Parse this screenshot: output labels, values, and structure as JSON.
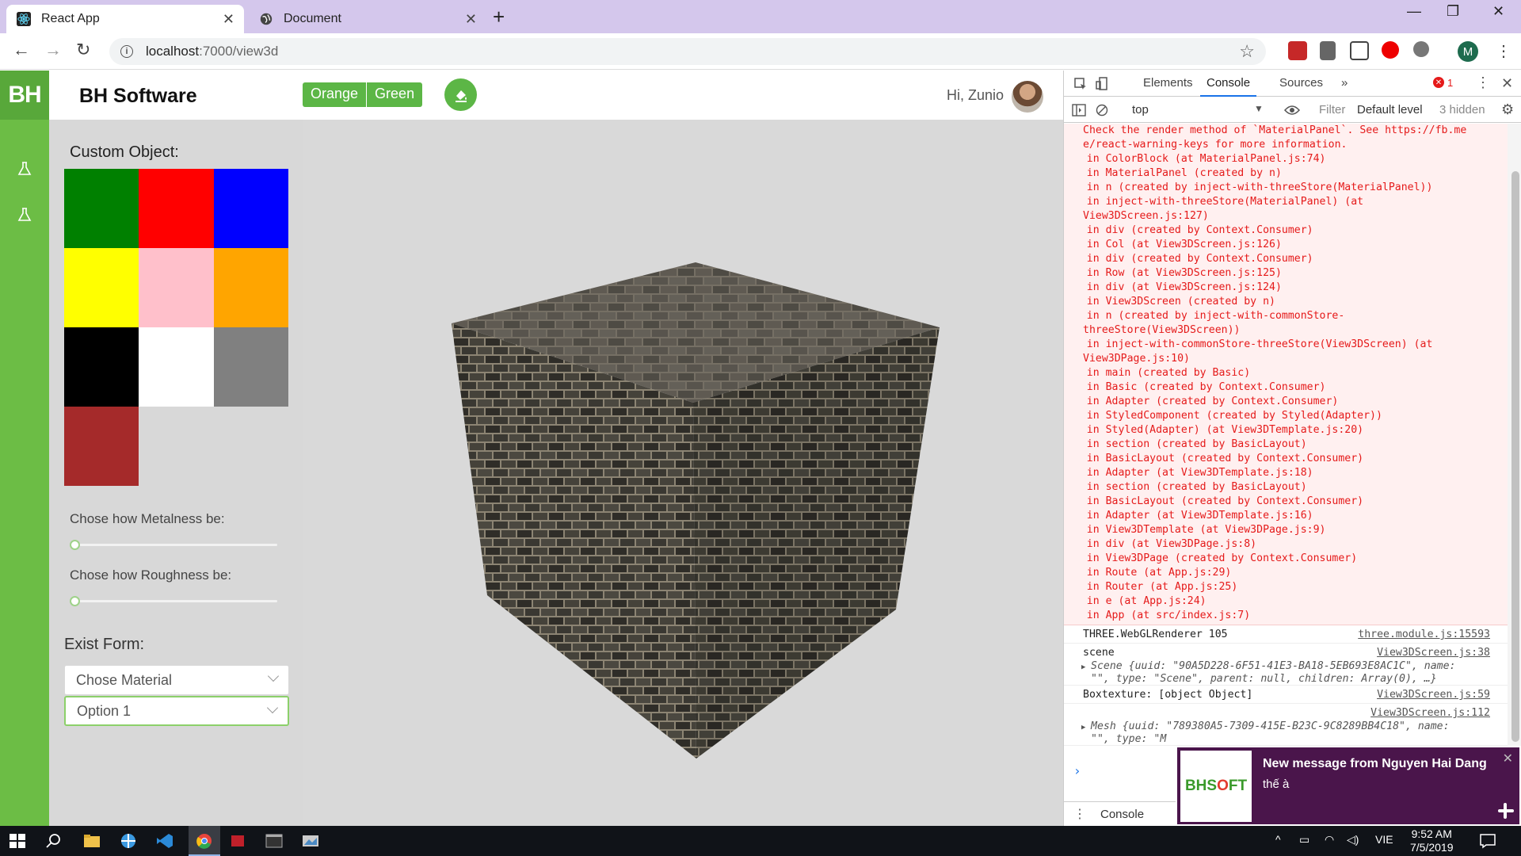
{
  "browser": {
    "tabs": [
      {
        "title": "React App",
        "close": "✕"
      },
      {
        "title": "Document",
        "close": "✕"
      }
    ],
    "new_tab": "+",
    "window_controls": [
      "—",
      "❐",
      "✕"
    ],
    "url_host": "localhost",
    "url_path": ":7000/view3d",
    "profile_initial": "M"
  },
  "app": {
    "logo": "BH",
    "brand": "BH Software",
    "theme_buttons": [
      "Orange",
      "Green"
    ],
    "greeting": "Hi, Zunio",
    "panel": {
      "custom_object_label": "Custom Object:",
      "colors": [
        "#008000",
        "#ff0000",
        "#0000ff",
        "#ffff00",
        "#ffc0cb",
        "#ffa500",
        "#000000",
        "#ffffff",
        "#808080",
        "#a52a2a"
      ],
      "metalness_label": "Chose how Metalness be:",
      "metalness_value": 0,
      "roughness_label": "Chose how Roughness be:",
      "roughness_value": 0,
      "exist_form_label": "Exist Form:",
      "material_placeholder": "Chose Material",
      "option_value": "Option 1"
    },
    "accent_color": "#5cb646"
  },
  "devtools": {
    "tabs": [
      "Elements",
      "Console",
      "Sources",
      "»"
    ],
    "error_count": "1",
    "context": "top",
    "filter_placeholder": "Filter",
    "level": "Default level",
    "hidden": "3 hidden",
    "error_lines": [
      "Check the render method of `MaterialPanel`. See https://fb.me",
      "e/react-warning-keys for more information.",
      "    in ColorBlock (at MaterialPanel.js:74)",
      "    in MaterialPanel (created by n)",
      "    in n (created by inject-with-threeStore(MaterialPanel))",
      "    in inject-with-threeStore(MaterialPanel) (at",
      "View3DScreen.js:127)",
      "    in div (created by Context.Consumer)",
      "    in Col (at View3DScreen.js:126)",
      "    in div (created by Context.Consumer)",
      "    in Row (at View3DScreen.js:125)",
      "    in div (at View3DScreen.js:124)",
      "    in View3DScreen (created by n)",
      "    in n (created by inject-with-commonStore-",
      "threeStore(View3DScreen))",
      "    in inject-with-commonStore-threeStore(View3DScreen) (at",
      "View3DPage.js:10)",
      "    in main (created by Basic)",
      "    in Basic (created by Context.Consumer)",
      "    in Adapter (created by Context.Consumer)",
      "    in StyledComponent (created by Styled(Adapter))",
      "    in Styled(Adapter) (at View3DTemplate.js:20)",
      "    in section (created by BasicLayout)",
      "    in BasicLayout (created by Context.Consumer)",
      "    in Adapter (at View3DTemplate.js:18)",
      "    in section (created by BasicLayout)",
      "    in BasicLayout (created by Context.Consumer)",
      "    in Adapter (at View3DTemplate.js:16)",
      "    in View3DTemplate (at View3DPage.js:9)",
      "    in div (at View3DPage.js:8)",
      "    in View3DPage (created by Context.Consumer)",
      "    in Route (at App.js:29)",
      "    in Router (at App.js:25)",
      "    in e (at App.js:24)",
      "    in App (at src/index.js:7)"
    ],
    "logs": [
      {
        "text": "THREE.WebGLRenderer 105",
        "source": "three.module.js:15593"
      },
      {
        "text": "scene",
        "source": "View3DScreen.js:38",
        "detail1": "Scene {uuid: \"90A5D228-6F51-41E3-BA18-5EB693E8AC1C\", name:",
        "detail2": "\"\", type: \"Scene\", parent: null, children: Array(0), …}"
      },
      {
        "text": "Boxtexture: [object Object]",
        "source": "View3DScreen.js:59"
      },
      {
        "text": "",
        "source": "View3DScreen.js:112",
        "detail1": "Mesh {uuid: \"789380A5-7309-415E-B23C-9C8289BB4C18\", name:",
        "detail2": "\"\", type: \"M"
      }
    ],
    "prompt": "›",
    "drawer_tab": "Console"
  },
  "notification": {
    "app_logo_a": "BHS",
    "app_logo_b": "O",
    "app_logo_c": "FT",
    "title": "New message from Nguyen Hai Dang",
    "message": "thế à",
    "close": "✕"
  },
  "taskbar": {
    "language": "VIE",
    "time": "9:52 AM",
    "date": "7/5/2019"
  }
}
